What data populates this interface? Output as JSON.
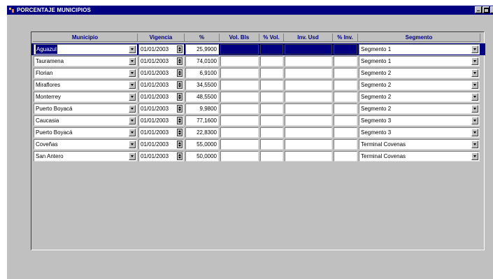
{
  "window": {
    "title": "PORCENTAJE MUNICIPIOS"
  },
  "columns": {
    "municipio": "Municipio",
    "vigencia": "Vigencia",
    "pct": "%",
    "vol_bls": "Vol. Bls",
    "pct_vol": "% Vol.",
    "inv_usd": "Inv. Usd",
    "pct_inv": "% Inv.",
    "segmento": "Segmento"
  },
  "rows": [
    {
      "municipio": "Aguazul",
      "vigencia": "01/01/2003",
      "pct": "25,9900",
      "vol_bls": "",
      "pct_vol": "",
      "inv_usd": "",
      "pct_inv": "",
      "segmento": "Segmento 1"
    },
    {
      "municipio": "Tauramena",
      "vigencia": "01/01/2003",
      "pct": "74,0100",
      "vol_bls": "",
      "pct_vol": "",
      "inv_usd": "",
      "pct_inv": "",
      "segmento": "Segmento 1"
    },
    {
      "municipio": "Florian",
      "vigencia": "01/01/2003",
      "pct": "6,9100",
      "vol_bls": "",
      "pct_vol": "",
      "inv_usd": "",
      "pct_inv": "",
      "segmento": "Segmento 2"
    },
    {
      "municipio": "Miraflores",
      "vigencia": "01/01/2003",
      "pct": "34,5500",
      "vol_bls": "",
      "pct_vol": "",
      "inv_usd": "",
      "pct_inv": "",
      "segmento": "Segmento 2"
    },
    {
      "municipio": "Monterrey",
      "vigencia": "01/01/2003",
      "pct": "48,5500",
      "vol_bls": "",
      "pct_vol": "",
      "inv_usd": "",
      "pct_inv": "",
      "segmento": "Segmento 2"
    },
    {
      "municipio": "Puerto Boyacá",
      "vigencia": "01/01/2003",
      "pct": "9,9800",
      "vol_bls": "",
      "pct_vol": "",
      "inv_usd": "",
      "pct_inv": "",
      "segmento": "Segmento 2"
    },
    {
      "municipio": "Caucasia",
      "vigencia": "01/01/2003",
      "pct": "77,1600",
      "vol_bls": "",
      "pct_vol": "",
      "inv_usd": "",
      "pct_inv": "",
      "segmento": "Segmento 3"
    },
    {
      "municipio": "Puerto Boyacá",
      "vigencia": "01/01/2003",
      "pct": "22,8300",
      "vol_bls": "",
      "pct_vol": "",
      "inv_usd": "",
      "pct_inv": "",
      "segmento": "Segmento 3"
    },
    {
      "municipio": "Coveñas",
      "vigencia": "01/01/2003",
      "pct": "55,0000",
      "vol_bls": "",
      "pct_vol": "",
      "inv_usd": "",
      "pct_inv": "",
      "segmento": "Terminal Covenas"
    },
    {
      "municipio": "San Antero",
      "vigencia": "01/01/2003",
      "pct": "50,0000",
      "vol_bls": "",
      "pct_vol": "",
      "inv_usd": "",
      "pct_inv": "",
      "segmento": "Terminal Covenas"
    }
  ],
  "selected_row": 0,
  "colors": {
    "titlebar": "#000080",
    "header_text": "#000080",
    "selection": "#000080",
    "background": "#c0c0c0"
  },
  "icons": {
    "app": "app-icon",
    "minimize": "minimize-icon",
    "maximize": "maximize-icon",
    "dropdown": "chevron-down-icon",
    "spinner": "spinner-icon"
  }
}
